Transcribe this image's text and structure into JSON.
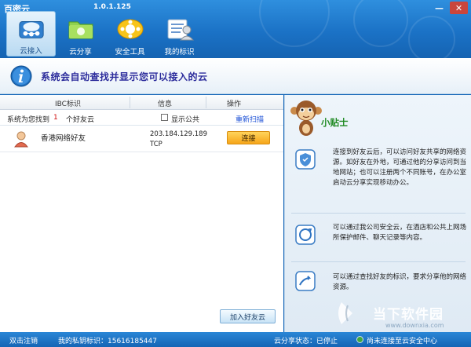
{
  "window": {
    "title": "百密云",
    "version": "1.0.1.125",
    "minimize_glyph": "—",
    "close_glyph": "✕"
  },
  "tabs": [
    {
      "label": "云接入",
      "icon": "cloud-network-icon",
      "active": true
    },
    {
      "label": "云分享",
      "icon": "folder-share-icon",
      "active": false
    },
    {
      "label": "安全工具",
      "icon": "security-tool-icon",
      "active": false
    },
    {
      "label": "我的标识",
      "icon": "my-id-icon",
      "active": false
    }
  ],
  "banner": {
    "text": "系统会自动查找并显示您可以接入的云",
    "icon": "info-icon"
  },
  "table": {
    "headers": {
      "id": "IBC标识",
      "info": "信息",
      "action": "操作"
    },
    "filter": {
      "prefix": "系统为您找到",
      "count": "1",
      "suffix": "个好友云",
      "show_public_label": "显示公共",
      "rescan_label": "重新扫描"
    },
    "rows": [
      {
        "name": "香港网络好友",
        "ip": "203.184.129.189",
        "protocol": "TCP",
        "action_label": "连接"
      }
    ]
  },
  "add_friend_label": "加入好友云",
  "tips": {
    "title": "小贴士",
    "items": [
      {
        "icon": "shield-icon",
        "text": "连接到好友云后，可以访问好友共享的网络资源。如好友在外地，可通过他的分享访问到当地网站；也可以注册两个不同账号，在办公室启动云分享实现移动办公。"
      },
      {
        "icon": "refresh-globe-icon",
        "text": "可以通过我公司安全云，在酒店和公共上网场所保护邮件、聊天记录等内容。"
      },
      {
        "icon": "share-hand-icon",
        "text": "可以通过查找好友的标识，要求分享他的网络资源。"
      }
    ],
    "watermark_text": "当下软件园",
    "watermark_url": "www.downxia.com"
  },
  "status": {
    "logout": "双击注销",
    "private_id_label": "我的私钥标识：15616185447",
    "share_status": "云分享状态：已停止",
    "connection": "尚未连接至云安全中心"
  },
  "colors": {
    "header": "#1b72c6",
    "accent_orange": "#f6a51a",
    "tips_title": "#1f8a22",
    "banner_text": "#2d2d9c",
    "count_red": "#d01010"
  }
}
